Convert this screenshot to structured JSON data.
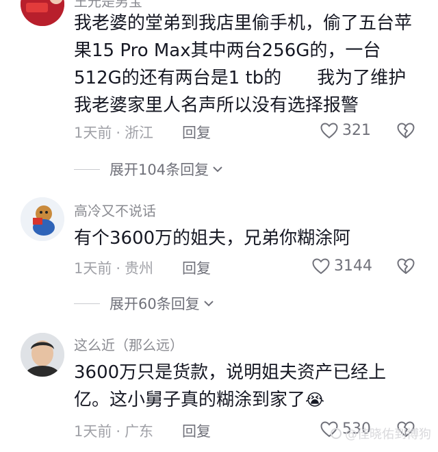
{
  "comments": [
    {
      "username": "王光是男宝",
      "content": "我老婆的堂弟到我店里偷手机，偷了五台苹果15 Pro Max其中两台256G的，一台512G的还有两台是1 tb的　　我为了维护我老婆家里人名声所以没有选择报警",
      "time": "1天前",
      "location": "浙江",
      "reply_label": "回复",
      "likes": "321",
      "expand_label": "展开104条回复"
    },
    {
      "username": "高冷又不说话",
      "content": "有个3600万的姐夫，兄弟你糊涂阿",
      "time": "1天前",
      "location": "贵州",
      "reply_label": "回复",
      "likes": "3144",
      "expand_label": "展开60条回复"
    },
    {
      "username": "这么近（那么远）",
      "content": "3600万只是货款，说明姐夫资产已经上亿。这小舅子真的糊涂到家了",
      "emoji": "😭",
      "time": "1天前",
      "location": "广东",
      "reply_label": "回复",
      "likes": "530"
    }
  ],
  "watermark": "@佳晓佑到博狗",
  "separator": "·"
}
